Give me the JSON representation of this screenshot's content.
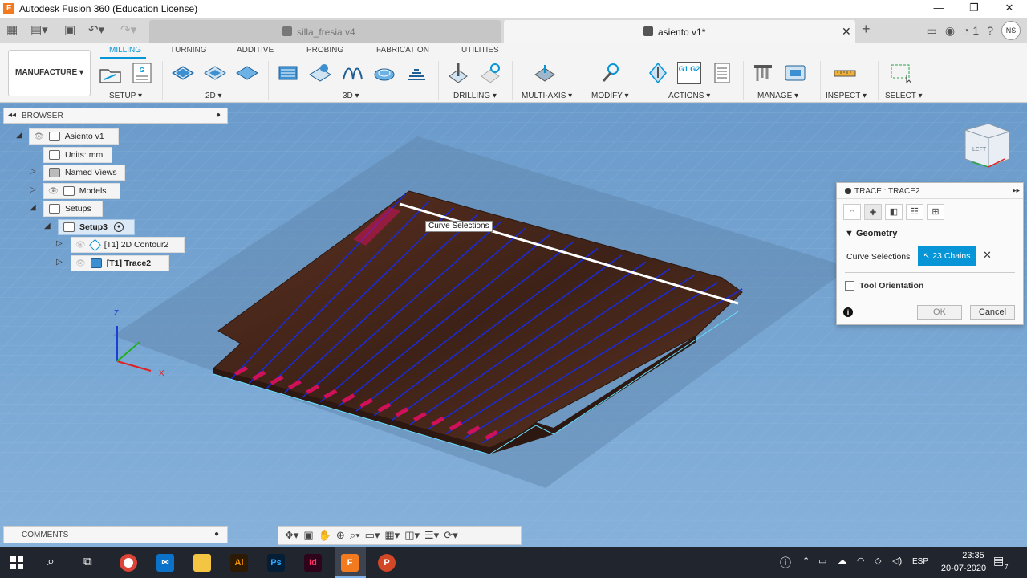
{
  "window": {
    "title": "Autodesk Fusion 360 (Education License)",
    "minimize": "—",
    "restore": "❐",
    "close": "✕"
  },
  "tabs": [
    {
      "label": "silla_fresia v4",
      "active": false
    },
    {
      "label": "asiento v1*",
      "active": true
    }
  ],
  "header_right": {
    "job_count": "1",
    "user_initials": "NS"
  },
  "ribbon": {
    "workspace": "MANUFACTURE",
    "tabs": [
      "MILLING",
      "TURNING",
      "ADDITIVE",
      "PROBING",
      "FABRICATION",
      "UTILITIES"
    ],
    "active_tab": "MILLING",
    "groups": [
      "SETUP ▾",
      "2D ▾",
      "3D ▾",
      "DRILLING ▾",
      "MULTI-AXIS ▾",
      "MODIFY ▾",
      "ACTIONS ▾",
      "MANAGE ▾",
      "INSPECT ▾",
      "SELECT ▾"
    ],
    "nc_icon_text": "G1 G2"
  },
  "browser": {
    "title": "BROWSER",
    "items": [
      {
        "label": "Asiento v1"
      },
      {
        "label": "Units: mm"
      },
      {
        "label": "Named Views"
      },
      {
        "label": "Models"
      },
      {
        "label": "Setups"
      },
      {
        "label": "Setup3"
      },
      {
        "label": "[T1] 2D Contour2"
      },
      {
        "label": "[T1] Trace2"
      }
    ]
  },
  "comments": {
    "title": "COMMENTS"
  },
  "viewport": {
    "tooltip": "Curve Selections",
    "viewcube_face": "LEFT",
    "axis_z": "Z",
    "axis_x": "X"
  },
  "trace_dialog": {
    "title": "TRACE : TRACE2",
    "section": "Geometry",
    "curve_selections_label": "Curve Selections",
    "chains_value": "23 Chains",
    "tool_orientation_label": "Tool Orientation",
    "tool_orientation_checked": false,
    "ok": "OK",
    "cancel": "Cancel",
    "info": "i"
  },
  "taskbar": {
    "language": "ESP",
    "time": "23:35",
    "date": "20-07-2020",
    "notification_count": "7"
  },
  "colors": {
    "accent": "#0696d7",
    "toolpath": "#1a2bd6",
    "lead_marker": "#d0115a",
    "wood": "#4a2a1c"
  }
}
